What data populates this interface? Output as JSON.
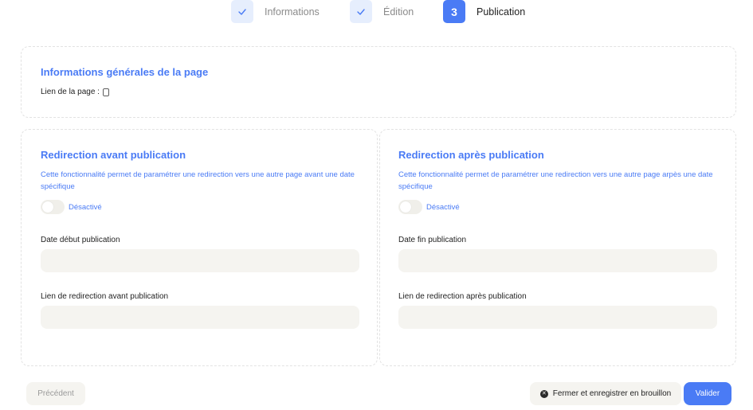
{
  "stepper": {
    "steps": [
      {
        "number": "",
        "label": "Informations",
        "state": "done"
      },
      {
        "number": "",
        "label": "Édition",
        "state": "done"
      },
      {
        "number": "3",
        "label": "Publication",
        "state": "active"
      }
    ]
  },
  "general": {
    "title": "Informations générales de la page",
    "link_label": "Lien de la page :"
  },
  "before": {
    "title": "Redirection avant publication",
    "description": "Cette fonctionnalité permet de paramétrer une redirection vers une autre page avant une date spécifique",
    "toggle_label": "Désactivé",
    "toggle_on": false,
    "date_label": "Date début publication",
    "date_value": "",
    "link_label": "Lien de redirection avant publication",
    "link_value": ""
  },
  "after": {
    "title": "Redirection après publication",
    "description": "Cette fonctionnalité permet de paramétrer une redirection vers une autre page arpès une date spécifique",
    "toggle_label": "Désactivé",
    "toggle_on": false,
    "date_label": "Date fin publication",
    "date_value": "",
    "link_label": "Lien de redirection après publication",
    "link_value": ""
  },
  "footer": {
    "previous_label": "Précédent",
    "close_label": "Fermer et enregistrer en brouillon",
    "validate_label": "Valider"
  },
  "colors": {
    "accent": "#4a7bf5",
    "input_bg": "#f5f4f0"
  },
  "icons": {
    "step_done": "check-icon",
    "copy": "copy-icon",
    "close": "close-circle-icon"
  }
}
